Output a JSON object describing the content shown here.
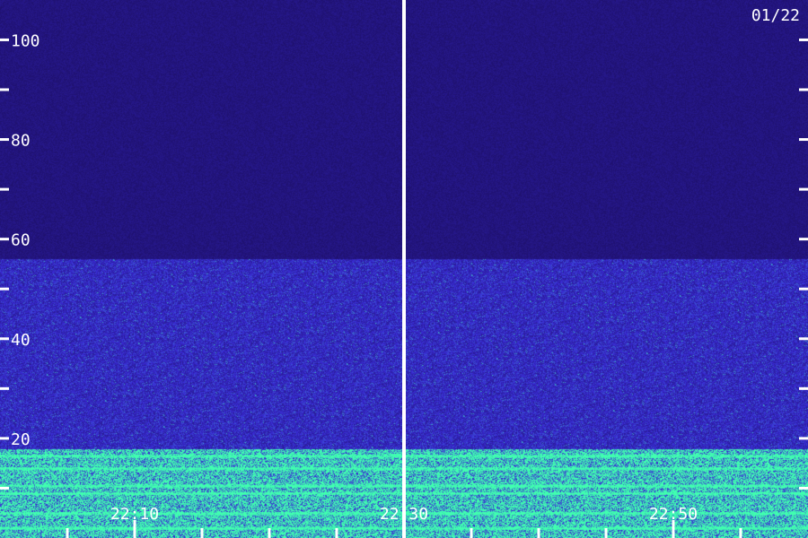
{
  "date_label": "01/22",
  "colors": {
    "background": "#12094a",
    "tick": "#ffffff",
    "label": "#ffffff",
    "divider": "#ffffff",
    "low_intensity": "#1a0c5c",
    "mid_intensity": "#3a2cd8",
    "high_intensity": "#40ffb0"
  },
  "chart_data": {
    "type": "heatmap",
    "title": "",
    "xlabel": "",
    "ylabel": "",
    "x_range": [
      "22:00",
      "23:00"
    ],
    "y_range": [
      0,
      108
    ],
    "y_tick_labels": [
      "100",
      "80",
      "60",
      "40",
      "20"
    ],
    "y_ticks": [
      100,
      90,
      80,
      70,
      60,
      50,
      40,
      30,
      20,
      10
    ],
    "x_tick_labels": [
      "22:10",
      "22:30",
      "22:50"
    ],
    "x_major_ticks": [
      "22:10",
      "22:30",
      "22:50"
    ],
    "x_minor_ticks": [
      "22:05",
      "22:15",
      "22:20",
      "22:25",
      "22:35",
      "22:40",
      "22:45",
      "22:55"
    ],
    "divider_time": "22:30",
    "intensity_bands": [
      {
        "y_from": 56,
        "y_to": 108,
        "level": 0.15
      },
      {
        "y_from": 18,
        "y_to": 56,
        "level": 0.45
      },
      {
        "y_from": 0,
        "y_to": 18,
        "level": 0.85
      }
    ],
    "strong_lines_y": [
      16.5,
      14,
      10.5,
      9,
      5,
      2
    ],
    "grid": false
  }
}
